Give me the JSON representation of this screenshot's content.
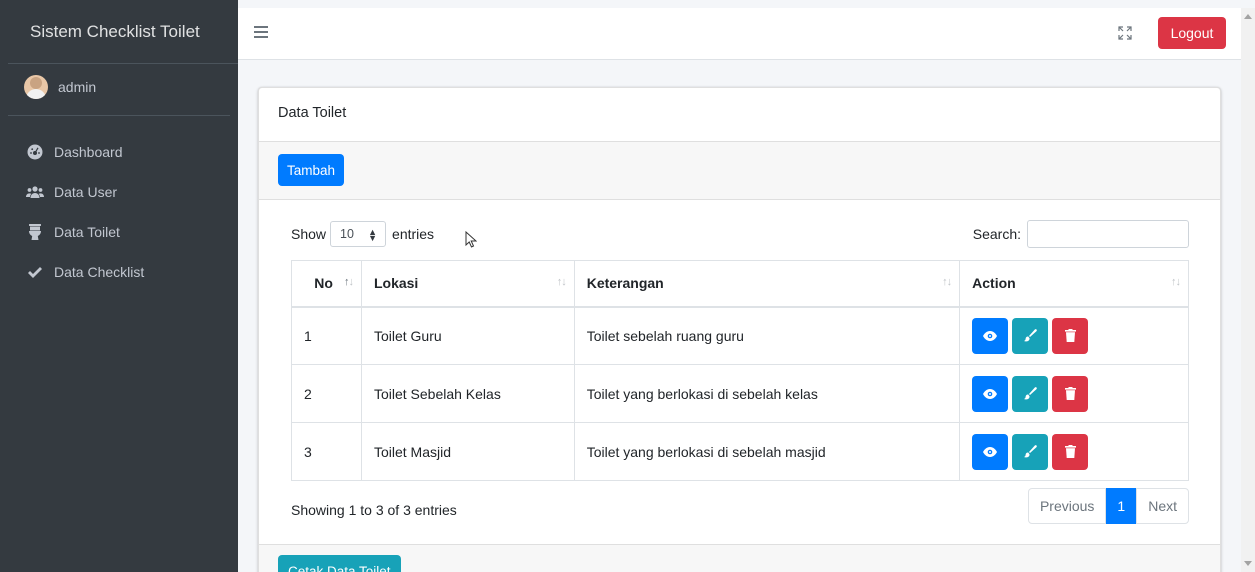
{
  "app": {
    "brand": "Sistem Checklist Toilet"
  },
  "user": {
    "name": "admin"
  },
  "sidebar": {
    "items": [
      {
        "label": "Dashboard",
        "icon": "dashboard-icon"
      },
      {
        "label": "Data User",
        "icon": "users-icon"
      },
      {
        "label": "Data Toilet",
        "icon": "toilet-icon"
      },
      {
        "label": "Data Checklist",
        "icon": "check-icon"
      }
    ]
  },
  "navbar": {
    "logout_label": "Logout"
  },
  "card": {
    "title": "Data Toilet",
    "add_label": "Tambah",
    "print_label": "Cetak Data Toilet"
  },
  "datatable": {
    "show_label": "Show",
    "entries_label": "entries",
    "page_length": "10",
    "search_label": "Search:",
    "search_value": "",
    "columns": [
      "No",
      "Lokasi",
      "Keterangan",
      "Action"
    ],
    "rows": [
      {
        "no": "1",
        "lokasi": "Toilet Guru",
        "keterangan": "Toilet sebelah ruang guru"
      },
      {
        "no": "2",
        "lokasi": "Toilet Sebelah Kelas",
        "keterangan": "Toilet yang berlokasi di sebelah kelas"
      },
      {
        "no": "3",
        "lokasi": "Toilet Masjid",
        "keterangan": "Toilet yang berlokasi di sebelah masjid"
      }
    ],
    "info": "Showing 1 to 3 of 3 entries",
    "pagination": {
      "previous": "Previous",
      "current": "1",
      "next": "Next"
    }
  },
  "colors": {
    "sidebar_bg": "#343a40",
    "primary": "#007bff",
    "info": "#17a2b8",
    "danger": "#dc3545"
  }
}
